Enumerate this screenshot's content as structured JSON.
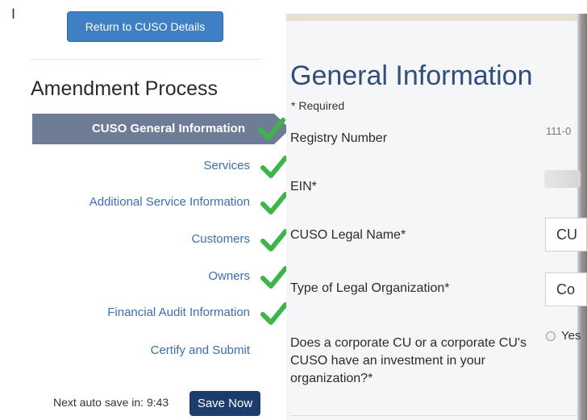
{
  "return_button": "Return to CUSO Details",
  "process_title": "Amendment Process",
  "steps": [
    {
      "label": "CUSO General Information",
      "active": true
    },
    {
      "label": "Services"
    },
    {
      "label": "Additional Service Information"
    },
    {
      "label": "Customers"
    },
    {
      "label": "Owners"
    },
    {
      "label": "Financial Audit Information"
    },
    {
      "label": "Certify and Submit"
    }
  ],
  "autosave": {
    "text": "Next auto save in: 9:43",
    "button": "Save Now"
  },
  "form": {
    "title": "General Information",
    "required_note": "* Required",
    "registry_label": "Registry Number",
    "registry_value": "111-0",
    "ein_label": "EIN*",
    "legal_name_label": "CUSO Legal Name*",
    "legal_name_value": "CU",
    "org_type_label": "Type of Legal Organization*",
    "org_type_value": "Co",
    "corporate_question": "Does a corporate CU or a corporate CU's CUSO have an investment in your organization?*",
    "radio_yes": "Yes"
  },
  "icons": {
    "check": "check-icon",
    "cursor": "text-cursor-icon"
  },
  "colors": {
    "check_green": "#3cb54a",
    "active_step": "#6e7c96",
    "link_blue": "#3a6fb1",
    "title_blue": "#2f4f7a"
  }
}
